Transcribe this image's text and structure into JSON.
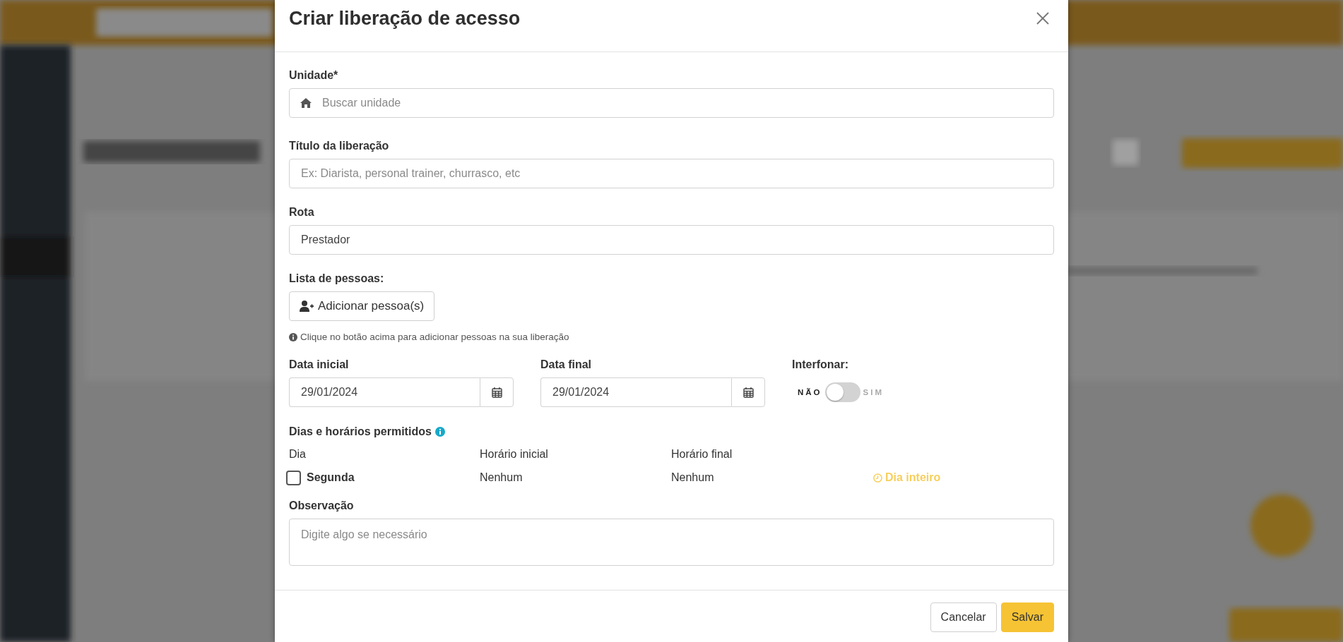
{
  "modal": {
    "title": "Criar liberação de acesso",
    "fields": [
      {
        "kind": "search",
        "label": "Unidade*",
        "placeholder": "Buscar unidade"
      },
      {
        "kind": "text",
        "label": "Título da liberação",
        "placeholder": "Ex: Diarista, personal trainer, churrasco, etc"
      },
      {
        "kind": "text",
        "label": "Rota",
        "value": "Prestador"
      }
    ],
    "people": {
      "label": "Lista de pessoas:",
      "button": "Adicionar pessoa(s)",
      "help": "Clique no botão acima para adicionar pessoas na sua liberação"
    },
    "dates": [
      {
        "label": "Data inicial",
        "value": "29/01/2024"
      },
      {
        "label": "Data final",
        "value": "29/01/2024"
      }
    ],
    "intercom": {
      "label": "Interfonar:",
      "off_label": "NÃO",
      "on_label": "SIM",
      "on": false
    },
    "schedule": {
      "title": "Dias e horários permitidos",
      "columns": [
        "Dia",
        "Horário inicial",
        "Horário final"
      ],
      "rows": [
        {
          "day": "Segunda",
          "checked": false,
          "start": "Nenhum",
          "end": "Nenhum",
          "all_day": "Dia inteiro"
        }
      ]
    },
    "notes": {
      "label": "Observação",
      "placeholder": "Digite algo se necessário"
    },
    "buttons": [
      {
        "kind": "secondary",
        "label": "Cancelar"
      },
      {
        "kind": "primary",
        "label": "Salvar"
      }
    ]
  }
}
